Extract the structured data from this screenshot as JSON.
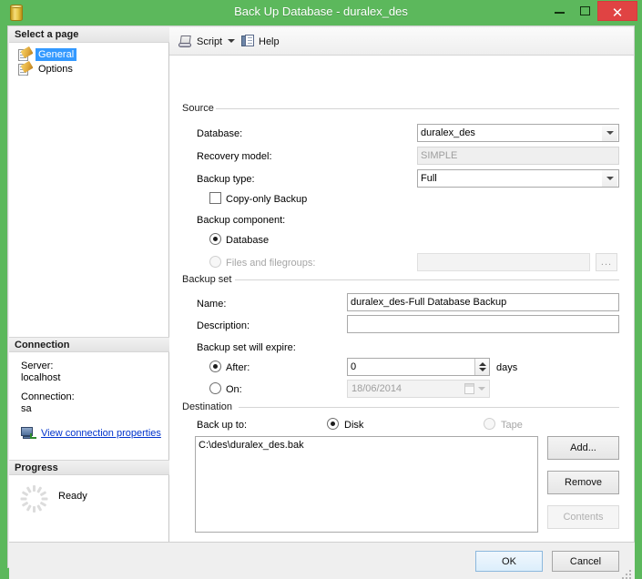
{
  "window": {
    "title": "Back Up Database - duralex_des",
    "icon": "database-cylinder-icon",
    "minimize_label": "—",
    "maximize_label": "□",
    "close_label": "✕",
    "frame_color": "#5cb85c",
    "close_color": "#e04343"
  },
  "sidebar": {
    "header": "Select a page",
    "pages": [
      {
        "label": "General",
        "selected": true
      },
      {
        "label": "Options",
        "selected": false
      }
    ],
    "connection": {
      "header": "Connection",
      "server_label": "Server:",
      "server_value": "localhost",
      "connection_label": "Connection:",
      "connection_value": "sa",
      "properties_link": "View connection properties"
    },
    "progress": {
      "header": "Progress",
      "status": "Ready"
    }
  },
  "toolbar": {
    "script_label": "Script",
    "help_label": "Help"
  },
  "source": {
    "group_title": "Source",
    "database_label": "Database:",
    "database_value": "duralex_des",
    "recovery_model_label": "Recovery model:",
    "recovery_model_value": "SIMPLE",
    "backup_type_label": "Backup type:",
    "backup_type_value": "Full",
    "copy_only_label": "Copy-only Backup",
    "copy_only_checked": false,
    "backup_component_label": "Backup component:",
    "component_database_label": "Database",
    "component_database_checked": true,
    "component_files_label": "Files and filegroups:",
    "component_files_checked": false,
    "files_value": "",
    "files_browse_label": "..."
  },
  "backup_set": {
    "group_title": "Backup set",
    "name_label": "Name:",
    "name_value": "duralex_des-Full Database Backup",
    "description_label": "Description:",
    "description_value": "",
    "expire_label": "Backup set will expire:",
    "after_label": "After:",
    "after_checked": true,
    "after_value": "0",
    "days_label": "days",
    "on_label": "On:",
    "on_checked": false,
    "on_value": "18/06/2014"
  },
  "destination": {
    "group_title": "Destination",
    "backup_to_label": "Back up to:",
    "disk_label": "Disk",
    "disk_checked": true,
    "tape_label": "Tape",
    "tape_checked": false,
    "tape_disabled": true,
    "paths": [
      "C:\\des\\duralex_des.bak"
    ],
    "add_label": "Add...",
    "remove_label": "Remove",
    "contents_label": "Contents",
    "contents_disabled": true
  },
  "footer": {
    "ok_label": "OK",
    "cancel_label": "Cancel"
  }
}
